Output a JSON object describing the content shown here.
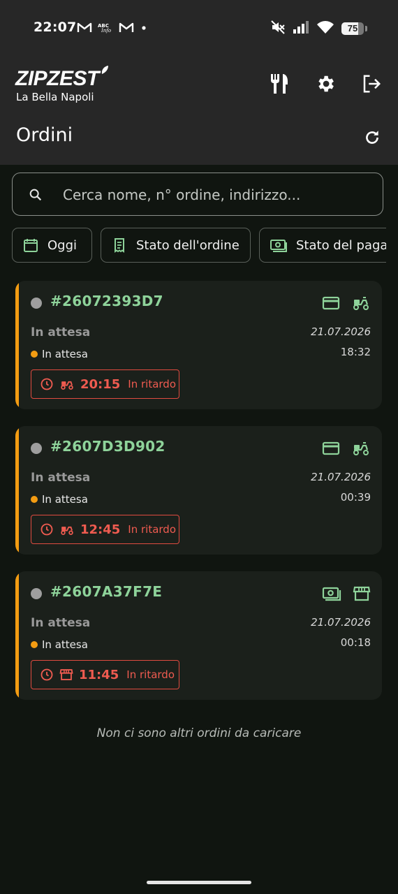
{
  "status_bar": {
    "time": "22:07",
    "left_icons": [
      "gmail-icon",
      "news-app-icon",
      "gmail-icon",
      "dot-icon"
    ],
    "right_icons": [
      "mute-icon",
      "signal-icon",
      "wifi-icon"
    ],
    "battery": "75",
    "battery_level": 0.75
  },
  "header": {
    "brand": "ZIPZEST",
    "restaurant": "La Bella Napoli",
    "actions": [
      "restaurant-icon",
      "settings-icon",
      "logout-icon"
    ],
    "title": "Ordini"
  },
  "search": {
    "placeholder": "Cerca nome, n° ordine, indirizzo..."
  },
  "filters": [
    {
      "label": "Oggi",
      "icon": "calendar-icon"
    },
    {
      "label": "Stato dell'ordine",
      "icon": "receipt-icon"
    },
    {
      "label": "Stato del pagar",
      "icon": "cash-icon"
    }
  ],
  "orders": [
    {
      "number": "#26072393D7",
      "payment_icon": "credit-card-icon",
      "type_icon": "delivery-scooter-icon",
      "status": "In attesa",
      "substatus": "In attesa",
      "date": "21.07.2026",
      "time": "18:32",
      "eta": "20:15",
      "late_label": "In ritardo"
    },
    {
      "number": "#2607D3D902",
      "payment_icon": "credit-card-icon",
      "type_icon": "delivery-scooter-icon",
      "status": "In attesa",
      "substatus": "In attesa",
      "date": "21.07.2026",
      "time": "00:39",
      "eta": "12:45",
      "late_label": "In ritardo"
    },
    {
      "number": "#2607A37F7E",
      "payment_icon": "cash-icon",
      "type_icon": "storefront-icon",
      "status": "In attesa",
      "substatus": "In attesa",
      "date": "21.07.2026",
      "time": "00:18",
      "eta": "11:45",
      "late_label": "In ritardo"
    }
  ],
  "footer_note": "Non ci sono altri ordini da caricare",
  "colors": {
    "background": "#101510",
    "header": "#272727",
    "card": "#1b201b",
    "accent_orange": "#f39c12",
    "order_number_green": "#8ed39a",
    "late_red": "#ef5b50"
  }
}
